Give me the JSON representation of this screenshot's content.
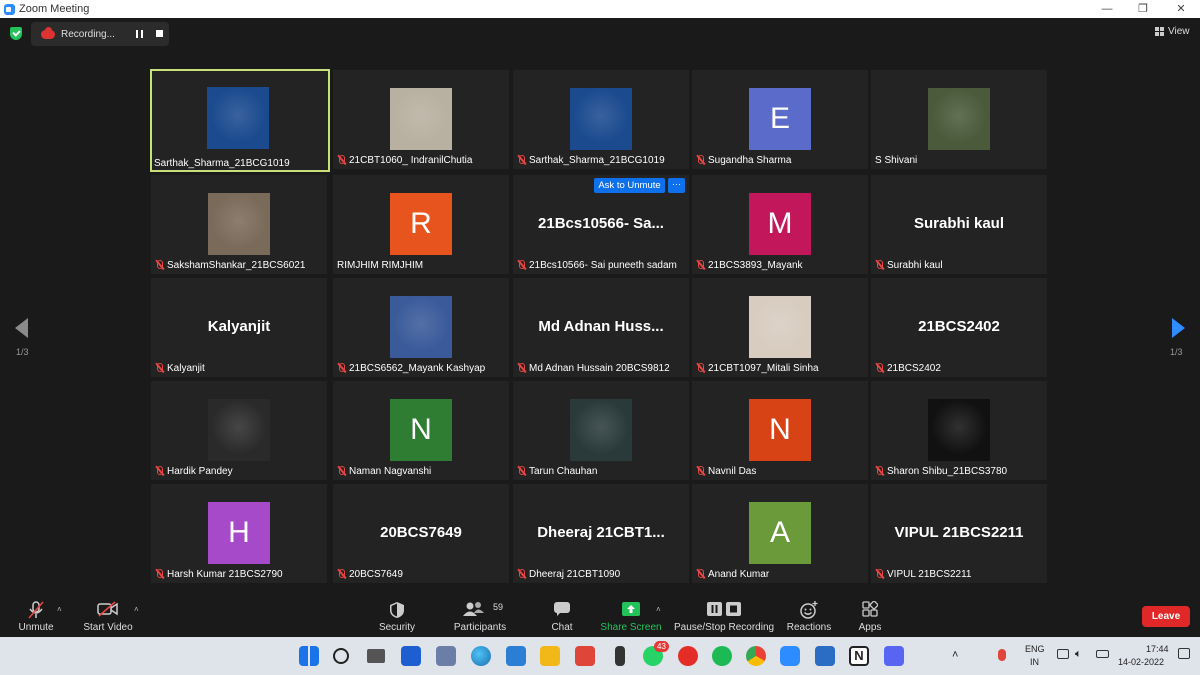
{
  "window": {
    "title": "Zoom Meeting",
    "minimize": "—",
    "restore": "❐"
  },
  "recording": {
    "label": "Recording..."
  },
  "view": {
    "label": "View"
  },
  "pager": {
    "left": "1/3",
    "right": "1/3"
  },
  "ask_unmute": {
    "label": "Ask to Unmute",
    "more": "···"
  },
  "tiles": [
    {
      "name": "Sarthak_Sharma_21BCG1019",
      "avatar_type": "image",
      "muted": false,
      "active": true,
      "image_color": "#1b4a8f"
    },
    {
      "name": "21CBT1060_ IndranilChutia",
      "avatar_type": "image",
      "muted": true,
      "image_color": "#b8b0a0"
    },
    {
      "name": "Sarthak_Sharma_21BCG1019",
      "avatar_type": "image",
      "muted": true,
      "image_color": "#1b4a8f"
    },
    {
      "name": "Sugandha Sharma",
      "avatar_type": "letter",
      "letter": "E",
      "color": "#5b6bc9",
      "muted": true
    },
    {
      "name": "S Shivani",
      "avatar_type": "image",
      "muted": false,
      "image_color": "#4a5a3a"
    },
    {
      "name": "SakshamShankar_21BCS6021",
      "avatar_type": "image",
      "muted": true,
      "image_color": "#7a6a5a"
    },
    {
      "name": "RIMJHIM RIMJHIM",
      "avatar_type": "letter",
      "letter": "R",
      "color": "#e8541d",
      "muted": false
    },
    {
      "name": "21Bcs10566- Sai puneeth sadam",
      "avatar_type": "text",
      "display": "21Bcs10566- Sa...",
      "muted": true
    },
    {
      "name": "21BCS3893_Mayank",
      "avatar_type": "letter",
      "letter": "M",
      "color": "#c2185b",
      "muted": true
    },
    {
      "name": "Surabhi kaul",
      "avatar_type": "text",
      "display": "Surabhi kaul",
      "muted": true
    },
    {
      "name": "Kalyanjit",
      "avatar_type": "text",
      "display": "Kalyanjit",
      "muted": true
    },
    {
      "name": "21BCS6562_Mayank Kashyap",
      "avatar_type": "image",
      "muted": true,
      "image_color": "#3a5a9a"
    },
    {
      "name": "Md Adnan Hussain 20BCS9812",
      "avatar_type": "text",
      "display": "Md Adnan Huss...",
      "muted": true
    },
    {
      "name": "21CBT1097_Mitali Sinha",
      "avatar_type": "image",
      "muted": true,
      "image_color": "#d8ccc0"
    },
    {
      "name": "21BCS2402",
      "avatar_type": "text",
      "display": "21BCS2402",
      "muted": true
    },
    {
      "name": "Hardik Pandey",
      "avatar_type": "image",
      "muted": true,
      "image_color": "#2a2a2a"
    },
    {
      "name": "Naman Nagvanshi",
      "avatar_type": "letter",
      "letter": "N",
      "color": "#2e7d32",
      "muted": true
    },
    {
      "name": "Tarun Chauhan",
      "avatar_type": "image",
      "muted": true,
      "image_color": "#2a3a3a"
    },
    {
      "name": "Navnil Das",
      "avatar_type": "letter",
      "letter": "N",
      "color": "#d84315",
      "muted": true
    },
    {
      "name": "Sharon Shibu_21BCS3780",
      "avatar_type": "image",
      "muted": true,
      "image_color": "#111111"
    },
    {
      "name": "Harsh Kumar 21BCS2790",
      "avatar_type": "letter",
      "letter": "H",
      "color": "#a64ac9",
      "muted": true
    },
    {
      "name": "20BCS7649",
      "avatar_type": "text",
      "display": "20BCS7649",
      "muted": true
    },
    {
      "name": "Dheeraj 21CBT1090",
      "avatar_type": "text",
      "display": "Dheeraj  21CBT1...",
      "muted": true
    },
    {
      "name": "Anand Kumar",
      "avatar_type": "letter",
      "letter": "A",
      "color": "#6a9a3a",
      "muted": true
    },
    {
      "name": "VIPUL 21BCS2211",
      "avatar_type": "text",
      "display": "VIPUL 21BCS2211",
      "muted": true
    }
  ],
  "toolbar": {
    "unmute": "Unmute",
    "start_video": "Start Video",
    "security": "Security",
    "participants": "Participants",
    "participants_count": "59",
    "chat": "Chat",
    "share_screen": "Share Screen",
    "pause_stop_recording": "Pause/Stop Recording",
    "reactions": "Reactions",
    "apps": "Apps",
    "leave": "Leave",
    "share_color": "#23c35a"
  },
  "taskbar": {
    "whatsapp_badge": "43",
    "lang_top": "ENG",
    "lang_bottom": "IN",
    "time": "17:44",
    "date": "14-02-2022"
  }
}
